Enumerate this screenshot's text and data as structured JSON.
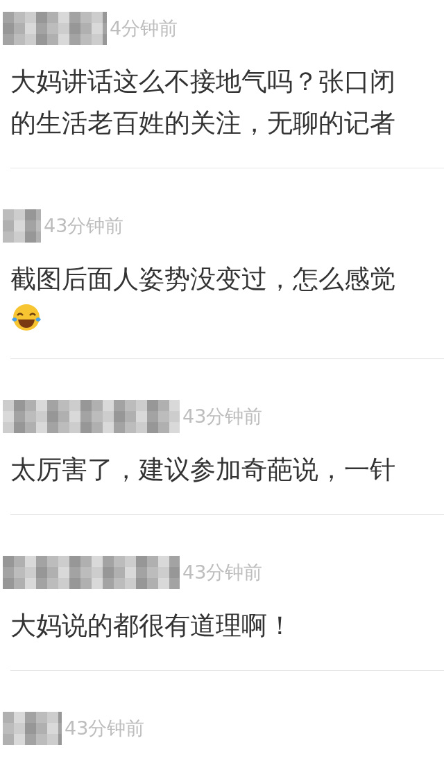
{
  "comments": [
    {
      "time": "4分钟前",
      "body": [
        {
          "kind": "text",
          "text": "大妈讲话这么不接地气吗？张口闭"
        },
        {
          "kind": "text",
          "text": "的生活老百姓的关注，无聊的记者"
        }
      ]
    },
    {
      "time": "43分钟前",
      "body": [
        {
          "kind": "text",
          "text": "截图后面人姿势没变过，怎么感觉"
        },
        {
          "kind": "emoji"
        }
      ]
    },
    {
      "time": "43分钟前",
      "body": [
        {
          "kind": "text",
          "text": "太厉害了，建议参加奇葩说，一针"
        }
      ]
    },
    {
      "time": "43分钟前",
      "body": [
        {
          "kind": "text",
          "text": "大妈说的都很有道理啊！"
        }
      ]
    },
    {
      "time": "43分钟前"
    }
  ]
}
